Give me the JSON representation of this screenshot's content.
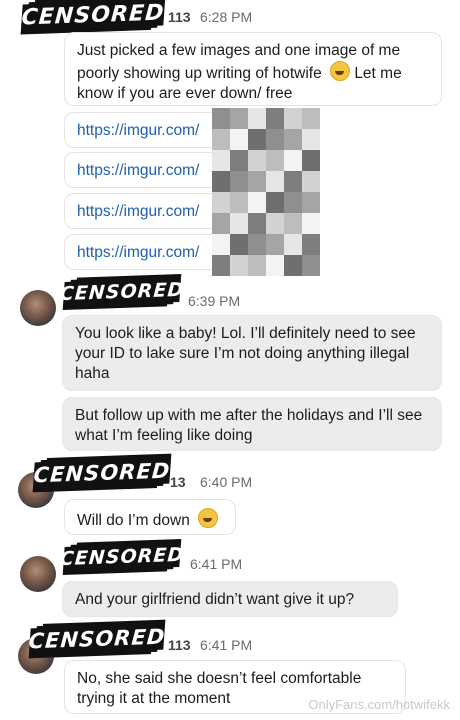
{
  "censor_label": "CENSORED",
  "messages": [
    {
      "sender_suffix": "113",
      "time": "6:28 PM",
      "text": "Just picked a few images and one image of me poorly showing up writing of hotwife",
      "text_end": "Let me know if you are ever down/ free",
      "emoji": "laughing-emoji"
    },
    {
      "link": "https://imgur.com/"
    },
    {
      "link": "https://imgur.com/"
    },
    {
      "link": "https://imgur.com/"
    },
    {
      "link": "https://imgur.com/"
    },
    {
      "time": "6:39 PM",
      "text": "You look like a baby! Lol. I’ll definitely need to see your ID to lake sure I’m not doing anything illegal haha"
    },
    {
      "text": "But follow up with me after the holidays and I’ll see what I’m feeling like doing"
    },
    {
      "sender_suffix": "13",
      "time": "6:40 PM",
      "text": "Will do I’m down",
      "emoji": "grinning-sweat-emoji"
    },
    {
      "time": "6:41 PM",
      "text": "And your girlfriend didn’t want give it up?"
    },
    {
      "sender_suffix": "113",
      "time": "6:41 PM",
      "text": "No, she said she doesn’t feel comfortable trying it at the moment"
    }
  ],
  "watermark": "OnlyFans.com/hotwifekk",
  "colors": {
    "link": "#1f5fa8",
    "grey_bubble": "#ececee",
    "censor_bar": "#111111"
  }
}
